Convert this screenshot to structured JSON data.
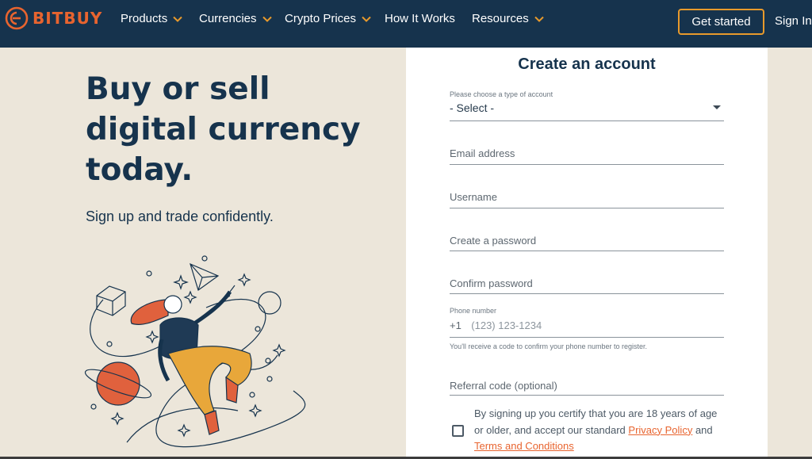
{
  "brand": {
    "name": "BITBUY",
    "accent": "#e8642f",
    "navy": "#16334d",
    "cta_border": "#e89a2c"
  },
  "nav": {
    "items": [
      {
        "label": "Products",
        "has_dropdown": true
      },
      {
        "label": "Currencies",
        "has_dropdown": true
      },
      {
        "label": "Crypto Prices",
        "has_dropdown": true
      },
      {
        "label": "How It Works",
        "has_dropdown": false
      },
      {
        "label": "Resources",
        "has_dropdown": true
      }
    ],
    "get_started": "Get started",
    "sign_in": "Sign In"
  },
  "hero": {
    "title": "Buy or sell digital currency today.",
    "subtitle": "Sign up and trade confidently."
  },
  "form": {
    "title": "Create an account",
    "account_type": {
      "label": "Please choose a type of account",
      "value": "- Select -"
    },
    "email": {
      "placeholder": "Email address"
    },
    "username": {
      "placeholder": "Username"
    },
    "password": {
      "placeholder": "Create a password"
    },
    "confirm_password": {
      "placeholder": "Confirm password"
    },
    "phone": {
      "label": "Phone number",
      "prefix": "+1",
      "placeholder": "(123) 123-1234",
      "helper": "You'll receive a code to confirm your phone number to register."
    },
    "referral": {
      "placeholder": "Referral code (optional)"
    },
    "consent": {
      "text_before": "By signing up you certify that you are 18 years of age or older, and accept our standard ",
      "privacy_link": "Privacy Policy",
      "and": " and ",
      "terms_link": "Terms and Conditions"
    }
  },
  "icons": [
    "bitbuy-logo-icon",
    "chevron-down-icon",
    "select-caret-icon",
    "checkbox-icon"
  ]
}
